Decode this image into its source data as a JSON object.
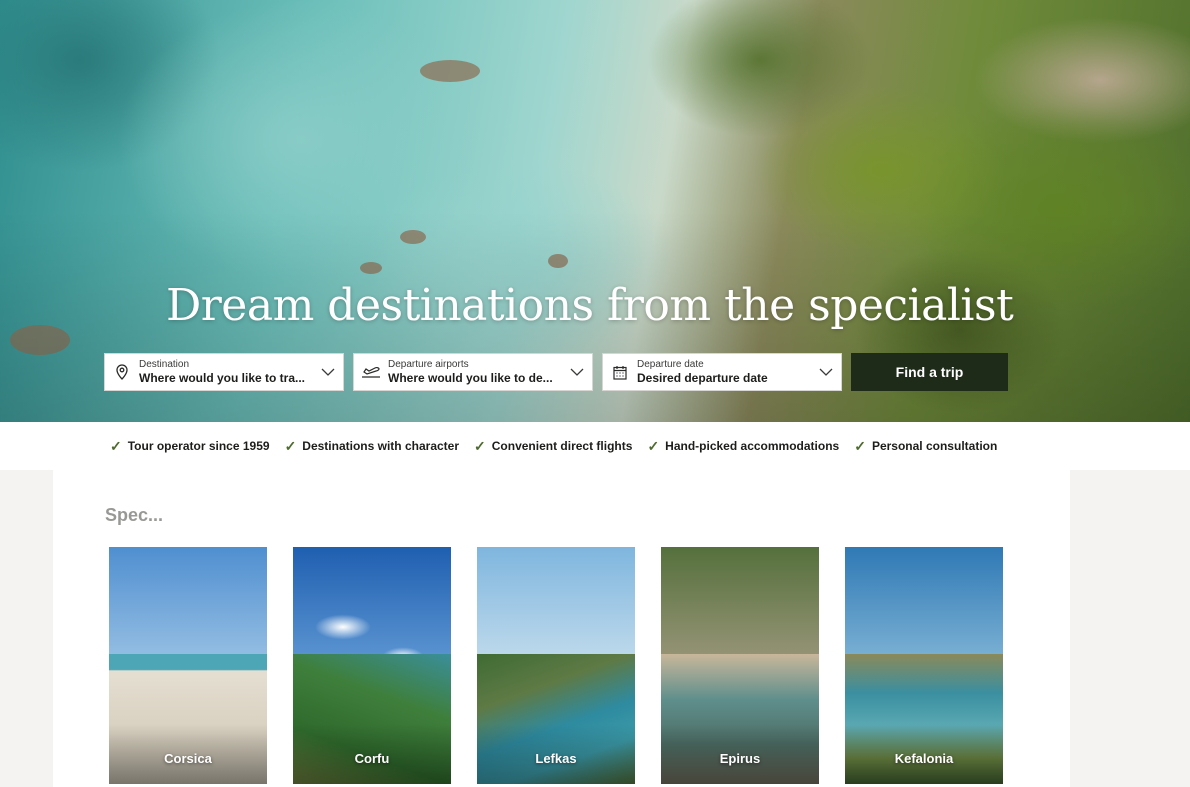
{
  "hero": {
    "title": "Dream destinations from the specialist",
    "destination": {
      "label": "Destination",
      "value": "Where would you like to tra..."
    },
    "airports": {
      "label": "Departure airports",
      "value": "Where would you like to de..."
    },
    "date": {
      "label": "Departure date",
      "value": "Desired departure date"
    },
    "cta": "Find a trip"
  },
  "usps": [
    "Tour operator since 1959",
    "Destinations with character",
    "Convenient direct flights",
    "Hand-picked accommodations",
    "Personal consultation"
  ],
  "specials": {
    "title": "Spec..."
  },
  "destinations": [
    "Corsica",
    "Corfu",
    "Lefkas",
    "Epirus",
    "Kefalonia"
  ],
  "colors": {
    "cta_bg": "#1e2b19",
    "check": "#4e6b2e"
  }
}
